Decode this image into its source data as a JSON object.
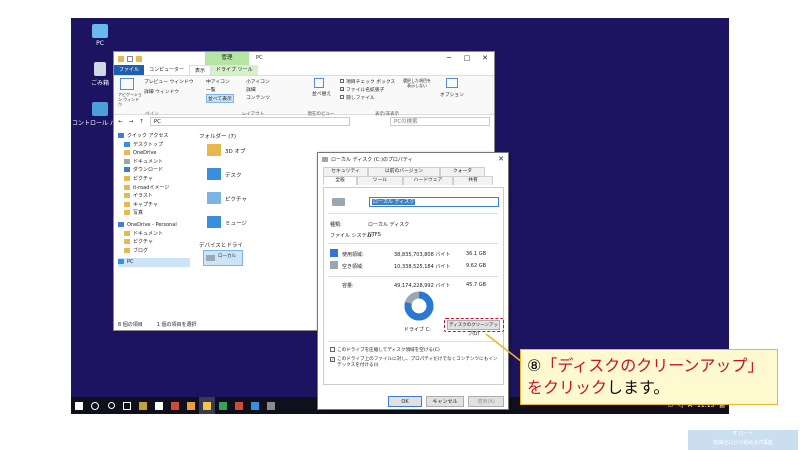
{
  "desktop_icons": [
    {
      "label": "PC",
      "color": "#6ab8f0"
    },
    {
      "label": "ごみ箱",
      "color": "#cfd8e4"
    },
    {
      "label": "コントロール パネル",
      "color": "#4aa0d8"
    }
  ],
  "explorer": {
    "manage_tab": "管理",
    "current_folder": "PC",
    "window_controls": [
      "─",
      "□",
      "✕"
    ],
    "ribbon_tabs": [
      "ファイル",
      "コンピューター",
      "表示",
      "ドライブ ツール"
    ],
    "ribbon": {
      "nav_pane": "ナビゲーション ウィンドウ",
      "preview_pane": "プレビュー ウィンドウ",
      "details_pane": "詳細 ウィンドウ",
      "pane_group": "ペイン",
      "large_icons": "中アイコン",
      "small_icons": "小アイコン",
      "list": "一覧",
      "details": "詳細",
      "tiles": "並べて表示",
      "content": "コンテンツ",
      "layout_group": "レイアウト",
      "sort": "並べ替え",
      "current_view_group": "現在のビュー",
      "item_checkbox": "項目チェック ボックス",
      "file_ext": "ファイル名拡張子",
      "hidden_items": "隠しファイル",
      "hide_selected": "選択した項目を表示しない",
      "show_hide_group": "表示/非表示",
      "options": "オプション"
    },
    "address": {
      "back": "←",
      "forward": "→",
      "up": "↑",
      "path": "PC",
      "search_placeholder": "PCの検索"
    },
    "nav_items": [
      {
        "label": "クイック アクセス",
        "color": "#3a7fd0"
      },
      {
        "label": "デスクトップ",
        "color": "#3a8fdc"
      },
      {
        "label": "OneDrive",
        "color": "#e8b84a"
      },
      {
        "label": "ドキュメント",
        "color": "#9aa6b2"
      },
      {
        "label": "ダウンロード",
        "color": "#3a7fd0"
      },
      {
        "label": "ピクチャ",
        "color": "#e8b84a"
      },
      {
        "label": "it-roadイメージ",
        "color": "#e8b84a"
      },
      {
        "label": "イラスト",
        "color": "#e8b84a"
      },
      {
        "label": "キャプチャ",
        "color": "#e8b84a"
      },
      {
        "label": "写真",
        "color": "#e8b84a"
      },
      {
        "label": "OneDrive - Personal",
        "color": "#3a7fd0"
      },
      {
        "label": "ドキュメント",
        "color": "#e8b84a"
      },
      {
        "label": "ピクチャ",
        "color": "#e8b84a"
      },
      {
        "label": "ブログ",
        "color": "#e8b84a"
      },
      {
        "label": "PC",
        "color": "#3a8fdc"
      }
    ],
    "content": {
      "folders_header": "フォルダー (7)",
      "folder1": "3D オブ",
      "folder2": "デスク",
      "folder3": "ピクチャ",
      "folder4": "ミュージ",
      "devices_header": "デバイスとドライ",
      "drive_label": "ローカル"
    },
    "status": {
      "items": "8 個の項目",
      "selected": "1 個の項目を選択"
    }
  },
  "dialog": {
    "title": "ローカル ディスク (C:)のプロパティ",
    "close": "✕",
    "tabs_row1": [
      "セキュリティ",
      "以前のバージョン",
      "クォータ"
    ],
    "tabs_row2": [
      "全般",
      "ツール",
      "ハードウェア",
      "共有"
    ],
    "name_value": "ローカル ディスク",
    "type_label": "種類:",
    "type_value": "ローカル ディスク",
    "fs_label": "ファイル システム:",
    "fs_value": "NTFS",
    "used_label": "使用領域:",
    "used_bytes": "38,835,703,808 バイト",
    "used_gb": "36.1 GB",
    "free_label": "空き領域:",
    "free_bytes": "10,338,525,184 バイト",
    "free_gb": "9.62 GB",
    "capacity_label": "容量:",
    "capacity_bytes": "49,174,228,992 バイト",
    "capacity_gb": "45.7 GB",
    "drive_label": "ドライブ C:",
    "cleanup_button": "ディスクのクリーンアップ(D)",
    "compress_option": "このドライブを圧縮してディスク領域を空ける(C)",
    "index_option": "このドライブ上のファイルに対し、プロパティだけでなくコンテンツにもインデックスを付ける(I)",
    "ok": "OK",
    "cancel": "キャンセル",
    "apply": "適用(A)",
    "used_color": "#2b78d2",
    "free_color": "#9aa6b2",
    "used_fraction": 0.79
  },
  "taskbar": {
    "clock": "11:15",
    "ime": "A"
  },
  "callout": {
    "line1_number": "⑧",
    "line1_red": "「ディスクのクリーンアップ」",
    "line2_red": "をクリック",
    "line2_black": "します。"
  },
  "watermark": {
    "line1": "IT ロード",
    "line2": "知識ゼロから始めるIT講座"
  }
}
